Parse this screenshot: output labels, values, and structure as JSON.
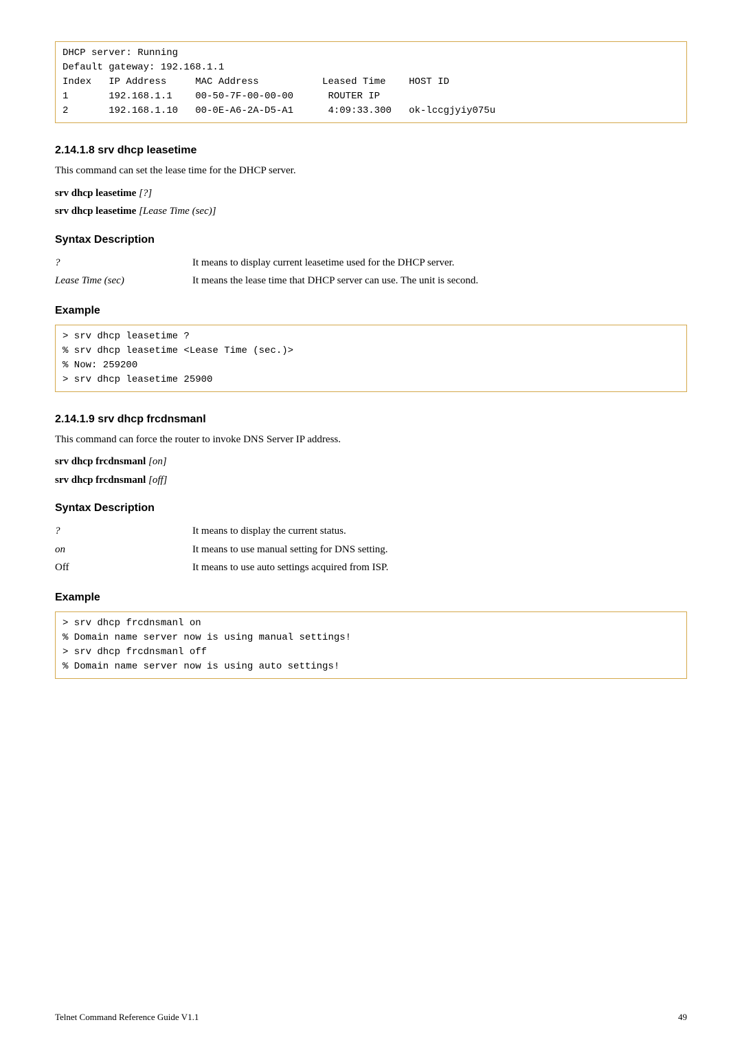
{
  "box1": "DHCP server: Running\nDefault gateway: 192.168.1.1\nIndex   IP Address     MAC Address           Leased Time    HOST ID\n1       192.168.1.1    00-50-7F-00-00-00      ROUTER IP\n2       192.168.1.10   00-0E-A6-2A-D5-A1      4:09:33.300   ok-lccgjyiy075u",
  "sec1": {
    "heading": "2.14.1.8 srv dhcp leasetime",
    "intro": "This command can set the lease time for the DHCP server.",
    "cmds": [
      {
        "bold": "srv dhcp leasetime",
        "ital": " [?]"
      },
      {
        "bold": "srv dhcp leasetime",
        "ital": " [Lease Time (sec)]"
      }
    ],
    "syntax_h": "Syntax Description",
    "syntax": [
      {
        "term": "?",
        "def": "It means to display current leasetime used for the DHCP server."
      },
      {
        "term": "Lease Time (sec)",
        "def": "It means the lease time that DHCP server can use. The unit is second."
      }
    ],
    "example_h": "Example",
    "example": "> srv dhcp leasetime ?\n% srv dhcp leasetime <Lease Time (sec.)>\n% Now: 259200\n> srv dhcp leasetime 25900"
  },
  "sec2": {
    "heading": "2.14.1.9 srv dhcp frcdnsmanl",
    "intro": "This command can force the router to invoke DNS Server IP address.",
    "cmds": [
      {
        "bold": "srv dhcp frcdnsmanl",
        "ital": " [on]"
      },
      {
        "bold": "srv dhcp frcdnsmanl",
        "ital": " [off]"
      }
    ],
    "syntax_h": "Syntax Description",
    "syntax": [
      {
        "term": "?",
        "def": "It means to display the current status.",
        "italic": true
      },
      {
        "term": "on",
        "def": "It means to use manual setting for DNS setting.",
        "italic": true
      },
      {
        "term": "Off",
        "def": "It means to use auto settings acquired from ISP.",
        "italic": false
      }
    ],
    "example_h": "Example",
    "example": "> srv dhcp frcdnsmanl on\n% Domain name server now is using manual settings!\n> srv dhcp frcdnsmanl off\n% Domain name server now is using auto settings!"
  },
  "footer": {
    "left": "Telnet Command Reference Guide V1.1",
    "right": "49"
  }
}
